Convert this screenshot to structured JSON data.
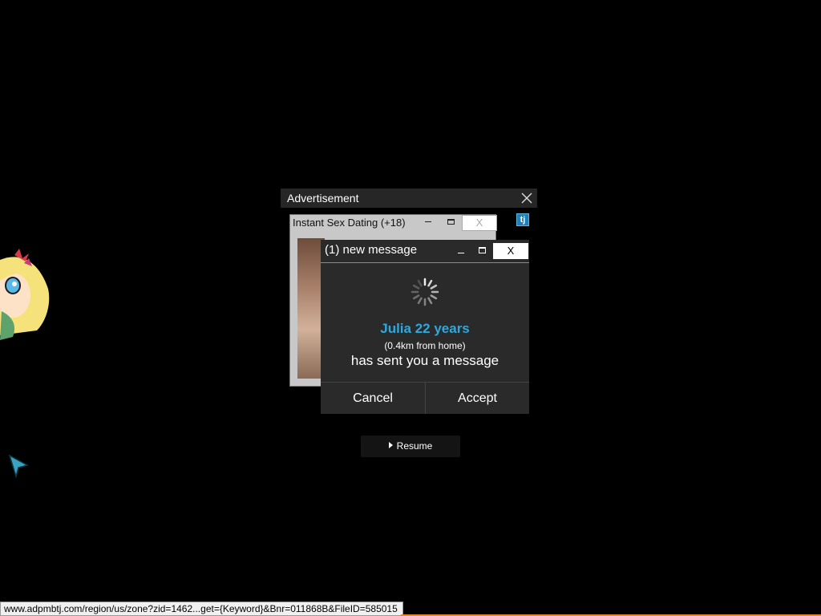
{
  "ad": {
    "header_label": "Advertisement",
    "close_icon": "close-icon",
    "badge_label": "tj"
  },
  "back_window": {
    "title": "Instant Sex Dating (+18)",
    "close_label": "X"
  },
  "message_window": {
    "title": "(1) new message",
    "close_label": "X",
    "name": "Julia 22 years",
    "distance": "(0.4km from home)",
    "text": "has sent you a message",
    "cancel_label": "Cancel",
    "accept_label": "Accept",
    "accent_color": "#2fa8dc"
  },
  "resume": {
    "label": "Resume"
  },
  "status_url": "www.adpmbtj.com/region/us/zone?zid=1462...get={Keyword}&Bnr=011868B&FileID=585015"
}
